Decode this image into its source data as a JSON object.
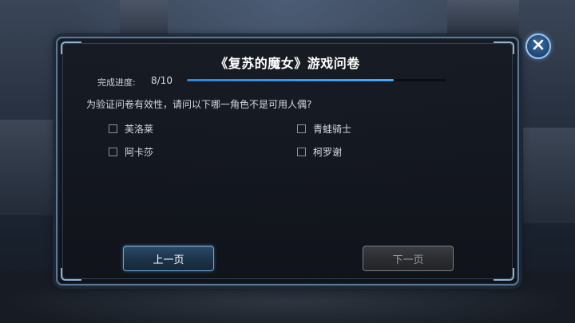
{
  "dialog": {
    "title": "《复苏的魔女》游戏问卷",
    "progress": {
      "label": "完成进度:",
      "count_text": "8/10",
      "fraction": 0.8
    },
    "question": "为验证问卷有效性，请问以下哪一角色不是可用人偶?",
    "options": [
      {
        "label": "芙洛莱",
        "checked": false
      },
      {
        "label": "青蛙骑士",
        "checked": false
      },
      {
        "label": "阿卡莎",
        "checked": false
      },
      {
        "label": "柯罗谢",
        "checked": false
      }
    ],
    "buttons": {
      "prev_label": "上一页",
      "next_label": "下一页",
      "next_enabled": false
    },
    "close_icon": "close-icon"
  },
  "colors": {
    "accent": "#4aa8ff",
    "panel_border": "#5a7896",
    "prev_button_border": "#6fa6d4",
    "disabled_text": "#9a9ea4"
  }
}
